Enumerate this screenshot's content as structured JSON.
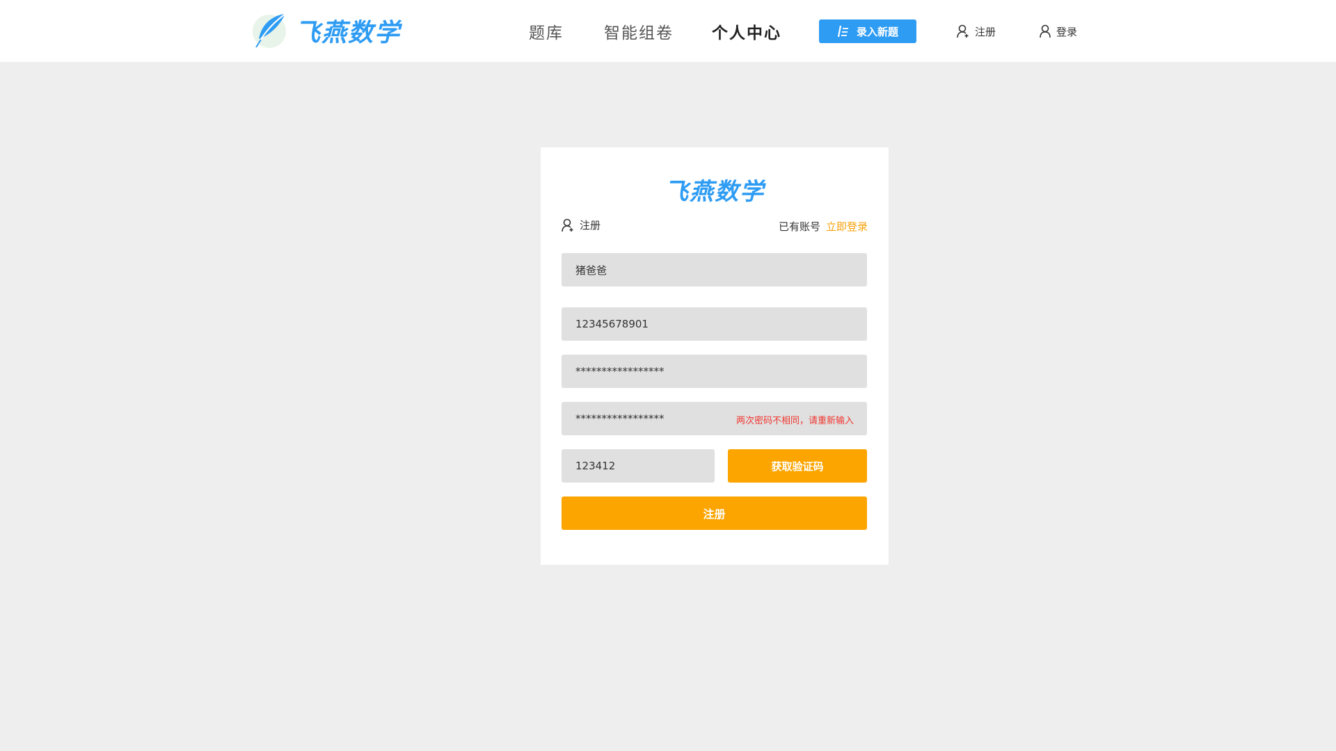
{
  "header": {
    "logo_text": "飞燕数学",
    "nav": [
      {
        "label": "题库"
      },
      {
        "label": "智能组卷"
      },
      {
        "label": "个人中心"
      }
    ],
    "add_question_label": "录入新题",
    "register_label": "注册",
    "login_label": "登录"
  },
  "card": {
    "logo_text": "飞燕数学",
    "title": "注册",
    "have_account": "已有账号",
    "login_now": "立即登录",
    "fields": {
      "name": "猪爸爸",
      "phone": "12345678901",
      "password": "*****************",
      "password_confirm": "*****************",
      "code": "123412"
    },
    "error_message": "两次密码不相同，请重新输入",
    "get_code_label": "获取验证码",
    "submit_label": "注册"
  },
  "colors": {
    "brand_blue": "#2f9cf4",
    "accent_orange": "#fca500",
    "error_red": "#f0362f",
    "background": "#eeeeee"
  }
}
